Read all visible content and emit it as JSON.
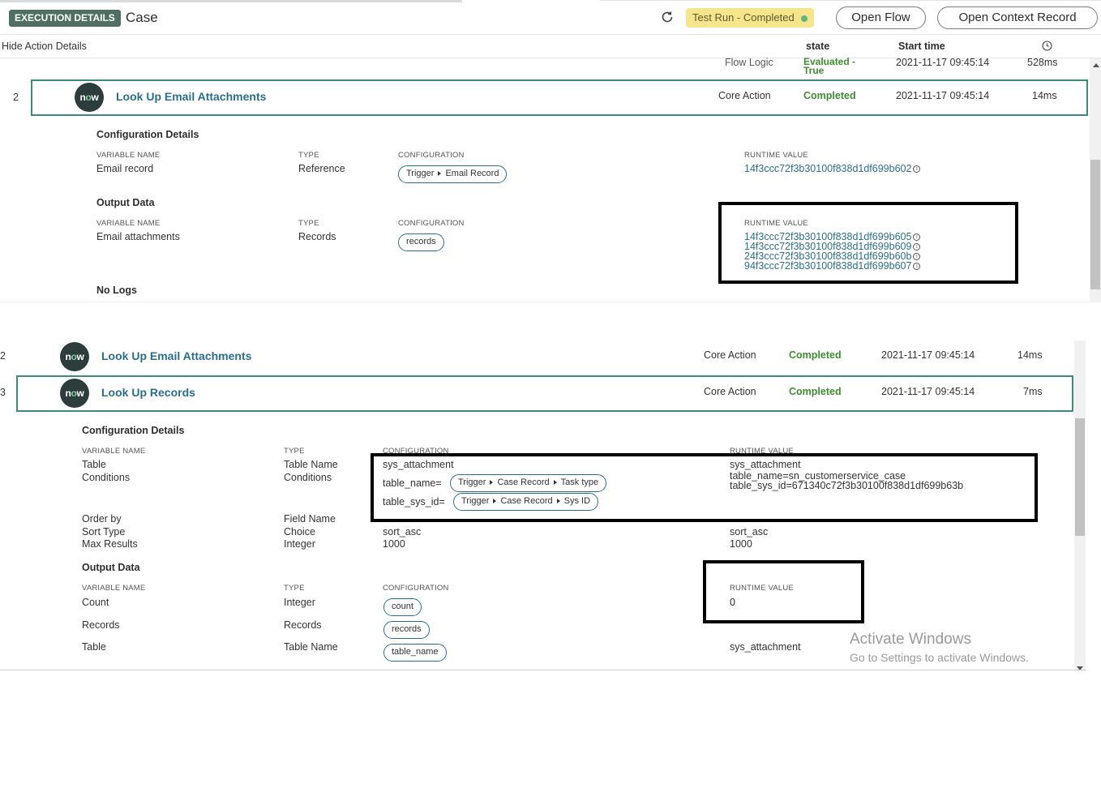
{
  "header": {
    "badge": "EXECUTION DETAILS",
    "title": "Case",
    "status": "Test Run - Completed",
    "open_flow": "Open Flow",
    "open_context": "Open Context Record",
    "hide_details": "Hide Action Details",
    "col_state": "state",
    "col_start": "Start time"
  },
  "panel1": {
    "prev_row": {
      "type": "Flow Logic",
      "state": "Evaluated - True",
      "start": "2021-11-17 09:45:14",
      "duration": "528ms"
    },
    "row": {
      "index": "2",
      "logo": "now",
      "title": "Look Up Email Attachments",
      "type": "Core Action",
      "state": "Completed",
      "start": "2021-11-17 09:45:14",
      "duration": "14ms"
    },
    "config_title": "Configuration Details",
    "headers": {
      "var": "VARIABLE NAME",
      "type": "TYPE",
      "config": "CONFIGURATION",
      "runtime": "RUNTIME VALUE"
    },
    "config_row": {
      "name": "Email record",
      "type": "Reference",
      "pill": [
        "Trigger",
        "Email Record"
      ],
      "runtime": "14f3ccc72f3b30100f838d1df699b602"
    },
    "output_title": "Output Data",
    "output_row": {
      "name": "Email attachments",
      "type": "Records",
      "pill": "records",
      "runtime": [
        "14f3ccc72f3b30100f838d1df699b605",
        "14f3ccc72f3b30100f838d1df699b609",
        "24f3ccc72f3b30100f838d1df699b60b",
        "94f3ccc72f3b30100f838d1df699b607"
      ]
    },
    "no_logs": "No Logs"
  },
  "panel2": {
    "row_a": {
      "index": "2",
      "logo": "now",
      "title": "Look Up Email Attachments",
      "type": "Core Action",
      "state": "Completed",
      "start": "2021-11-17 09:45:14",
      "duration": "14ms"
    },
    "row_b": {
      "index": "3",
      "logo": "now",
      "title": "Look Up Records",
      "type": "Core Action",
      "state": "Completed",
      "start": "2021-11-17 09:45:14",
      "duration": "7ms"
    },
    "config_title": "Configuration Details",
    "headers": {
      "var": "VARIABLE NAME",
      "type": "TYPE",
      "config": "CONFIGURATION",
      "runtime": "RUNTIME VALUE"
    },
    "config_rows": {
      "table": {
        "name": "Table",
        "type": "Table Name",
        "config": "sys_attachment",
        "runtime": "sys_attachment"
      },
      "conditions": {
        "name": "Conditions",
        "type": "Conditions",
        "cond1_prefix": "table_name=",
        "cond1_pill": [
          "Trigger",
          "Case Record",
          "Task type"
        ],
        "cond2_prefix": "table_sys_id=",
        "cond2_pill": [
          "Trigger",
          "Case Record",
          "Sys ID"
        ],
        "runtime1": "table_name=sn_customerservice_case",
        "runtime2": "table_sys_id=671340c72f3b30100f838d1df699b63b"
      },
      "order_by": {
        "name": "Order by",
        "type": "Field Name"
      },
      "sort_type": {
        "name": "Sort Type",
        "type": "Choice",
        "config": "sort_asc",
        "runtime": "sort_asc"
      },
      "max_results": {
        "name": "Max Results",
        "type": "Integer",
        "config": "1000",
        "runtime": "1000"
      }
    },
    "output_title": "Output Data",
    "output_rows": {
      "count": {
        "name": "Count",
        "type": "Integer",
        "pill": "count",
        "runtime": "0"
      },
      "records": {
        "name": "Records",
        "type": "Records",
        "pill": "records"
      },
      "table": {
        "name": "Table",
        "type": "Table Name",
        "pill": "table_name",
        "runtime": "sys_attachment"
      }
    }
  },
  "watermark": {
    "line1": "Activate Windows",
    "line2": "Go to Settings to activate Windows."
  },
  "colors": {
    "badge": "#4f6f62",
    "link": "#2a6e8e",
    "green": "#3f8e2e",
    "row_border": "#3c8a7b",
    "status_bg": "#f7e58b"
  }
}
